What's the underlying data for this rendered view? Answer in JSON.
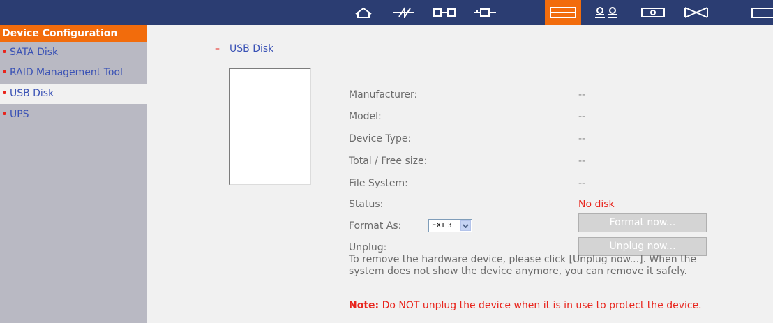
{
  "nav": {
    "icons": [
      "home-icon",
      "lightning-icon",
      "network-icon",
      "connector-icon",
      "device-config-icon",
      "users-icon",
      "disk-icon",
      "envelope-icon",
      "window-icon"
    ],
    "active_index": 4,
    "accent_color": "#f26c0c",
    "bar_color": "#2b3d72"
  },
  "sidebar": {
    "header": "Device Configuration",
    "items": [
      {
        "label": "SATA Disk"
      },
      {
        "label": "RAID Management Tool"
      },
      {
        "label": "USB Disk"
      },
      {
        "label": "UPS"
      }
    ],
    "active_index": 2
  },
  "main": {
    "section_title": "USB Disk",
    "fields": [
      {
        "label": "Manufacturer:",
        "value": "--"
      },
      {
        "label": "Model:",
        "value": "--"
      },
      {
        "label": "Device Type:",
        "value": "--"
      },
      {
        "label": "Total / Free size:",
        "value": "--"
      },
      {
        "label": "File System:",
        "value": "--"
      },
      {
        "label": "Status:",
        "value": "No disk"
      }
    ],
    "format_label": "Format As:",
    "format_select": "EXT 3",
    "format_button": "Format now...",
    "unplug_label": "Unplug:",
    "unplug_button": "Unplug now...",
    "info_text": "To remove the hardware device, please click [Unplug now...]. When the system does not show the device anymore, you can remove it safely.",
    "note_label": "Note:",
    "note_text": " Do NOT unplug the device when it is in use to protect the device."
  }
}
